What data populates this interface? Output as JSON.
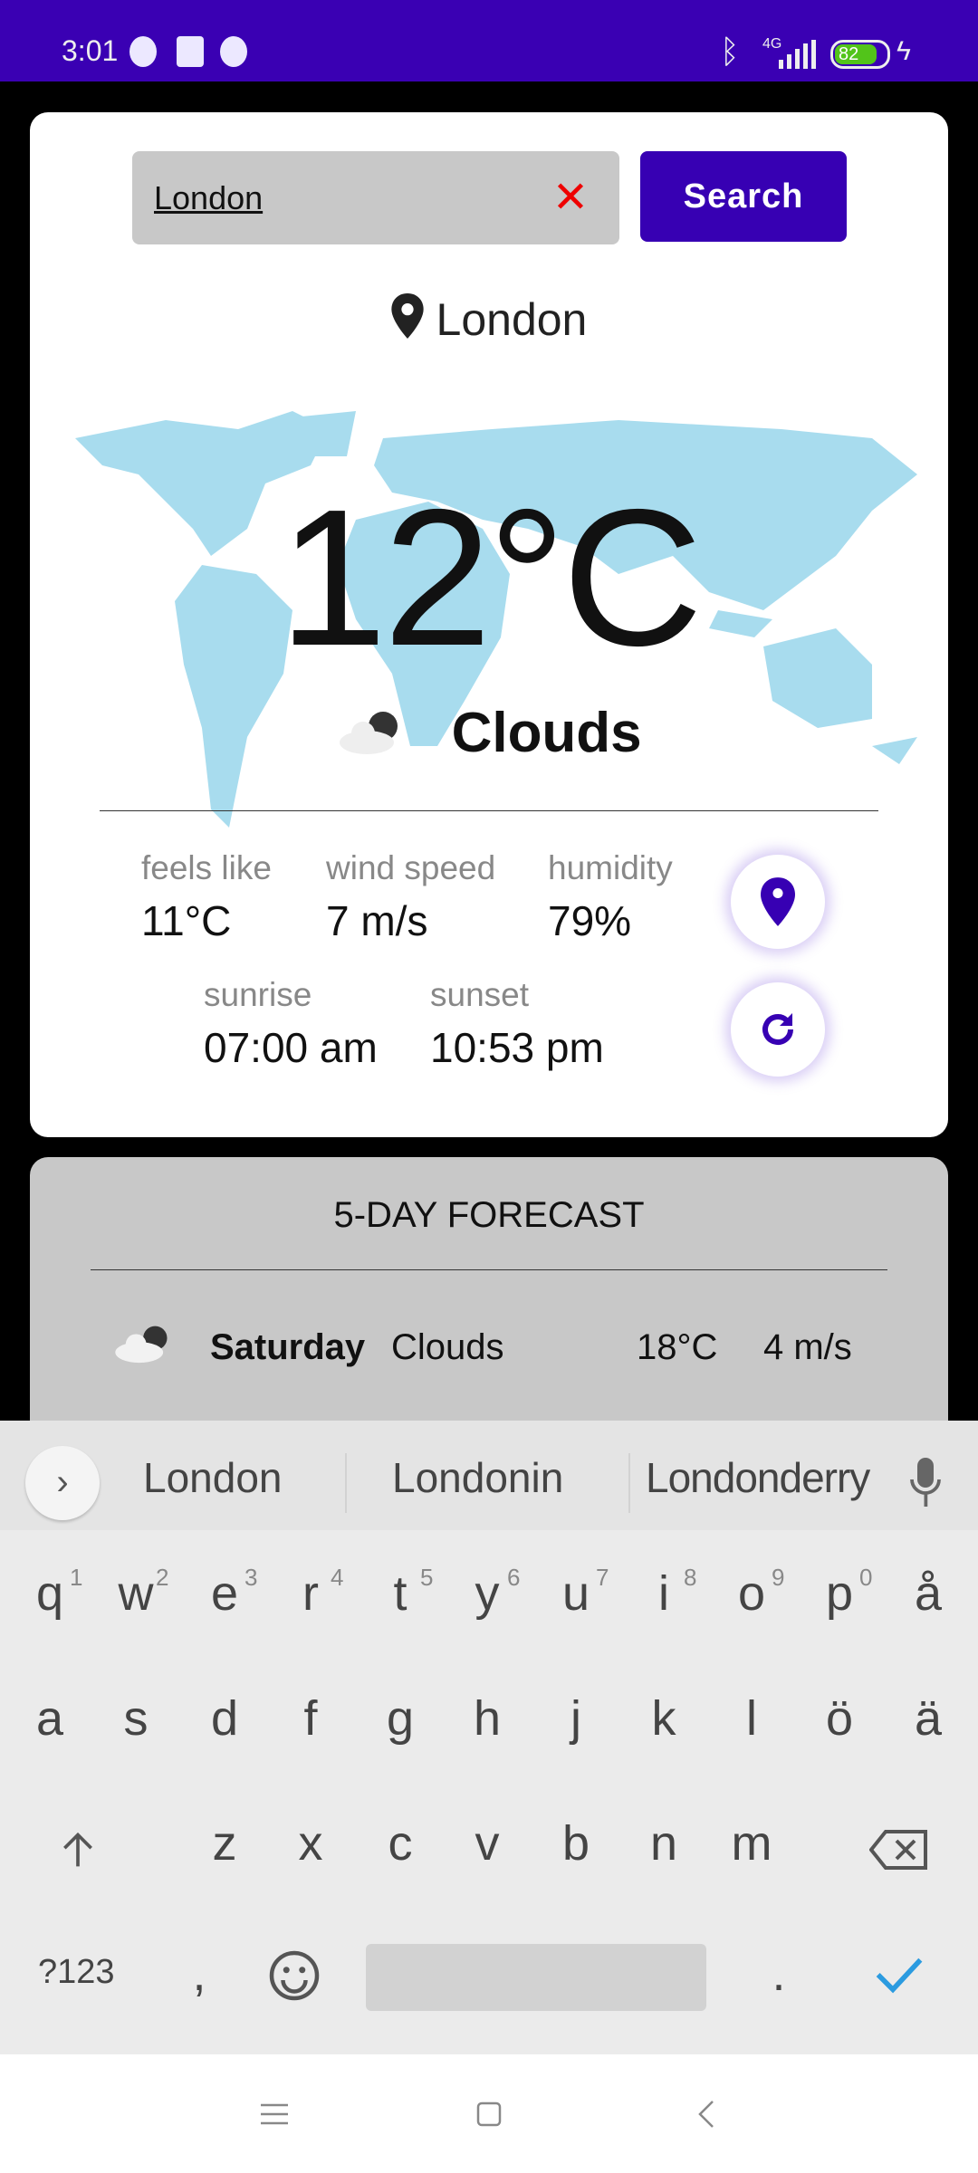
{
  "status_bar": {
    "time": "3:01",
    "network": "4G",
    "battery": "82",
    "colors": {
      "bar": "#3a00b3",
      "battery": "#52c41a"
    }
  },
  "search": {
    "value": "London",
    "placeholder": "",
    "clear_icon": "close-icon",
    "button_label": "Search"
  },
  "location": {
    "icon": "map-pin-icon",
    "name": "London"
  },
  "current": {
    "temperature": "12°C",
    "condition": "Clouds",
    "condition_icon": "cloud-sun-icon"
  },
  "details": [
    {
      "label": "feels like",
      "value": "11°C"
    },
    {
      "label": "wind speed",
      "value": "7 m/s"
    },
    {
      "label": "humidity",
      "value": "79%"
    },
    {
      "label": "sunrise",
      "value": "07:00 am"
    },
    {
      "label": "sunset",
      "value": "10:53 pm"
    }
  ],
  "actions": {
    "location_icon": "map-pin-icon",
    "refresh_icon": "refresh-icon"
  },
  "forecast": {
    "title": "5-DAY FORECAST",
    "rows": [
      {
        "day": "Saturday",
        "condition": "Clouds",
        "temp": "18°C",
        "wind": "4 m/s"
      }
    ]
  },
  "keyboard": {
    "suggestions": [
      "London",
      "Londonin",
      "Londonderry"
    ],
    "row1": [
      "q",
      "w",
      "e",
      "r",
      "t",
      "y",
      "u",
      "i",
      "o",
      "p",
      "å"
    ],
    "hints": [
      "1",
      "2",
      "3",
      "4",
      "5",
      "6",
      "7",
      "8",
      "9",
      "0"
    ],
    "row2": [
      "a",
      "s",
      "d",
      "f",
      "g",
      "h",
      "j",
      "k",
      "l",
      "ö",
      "ä"
    ],
    "row3": [
      "z",
      "x",
      "c",
      "v",
      "b",
      "n",
      "m"
    ],
    "symbols_label": "?123",
    "comma": ",",
    "period": "."
  },
  "colors": {
    "accent": "#3700b3",
    "map": "#a8dcee",
    "clear": "#e00000"
  }
}
